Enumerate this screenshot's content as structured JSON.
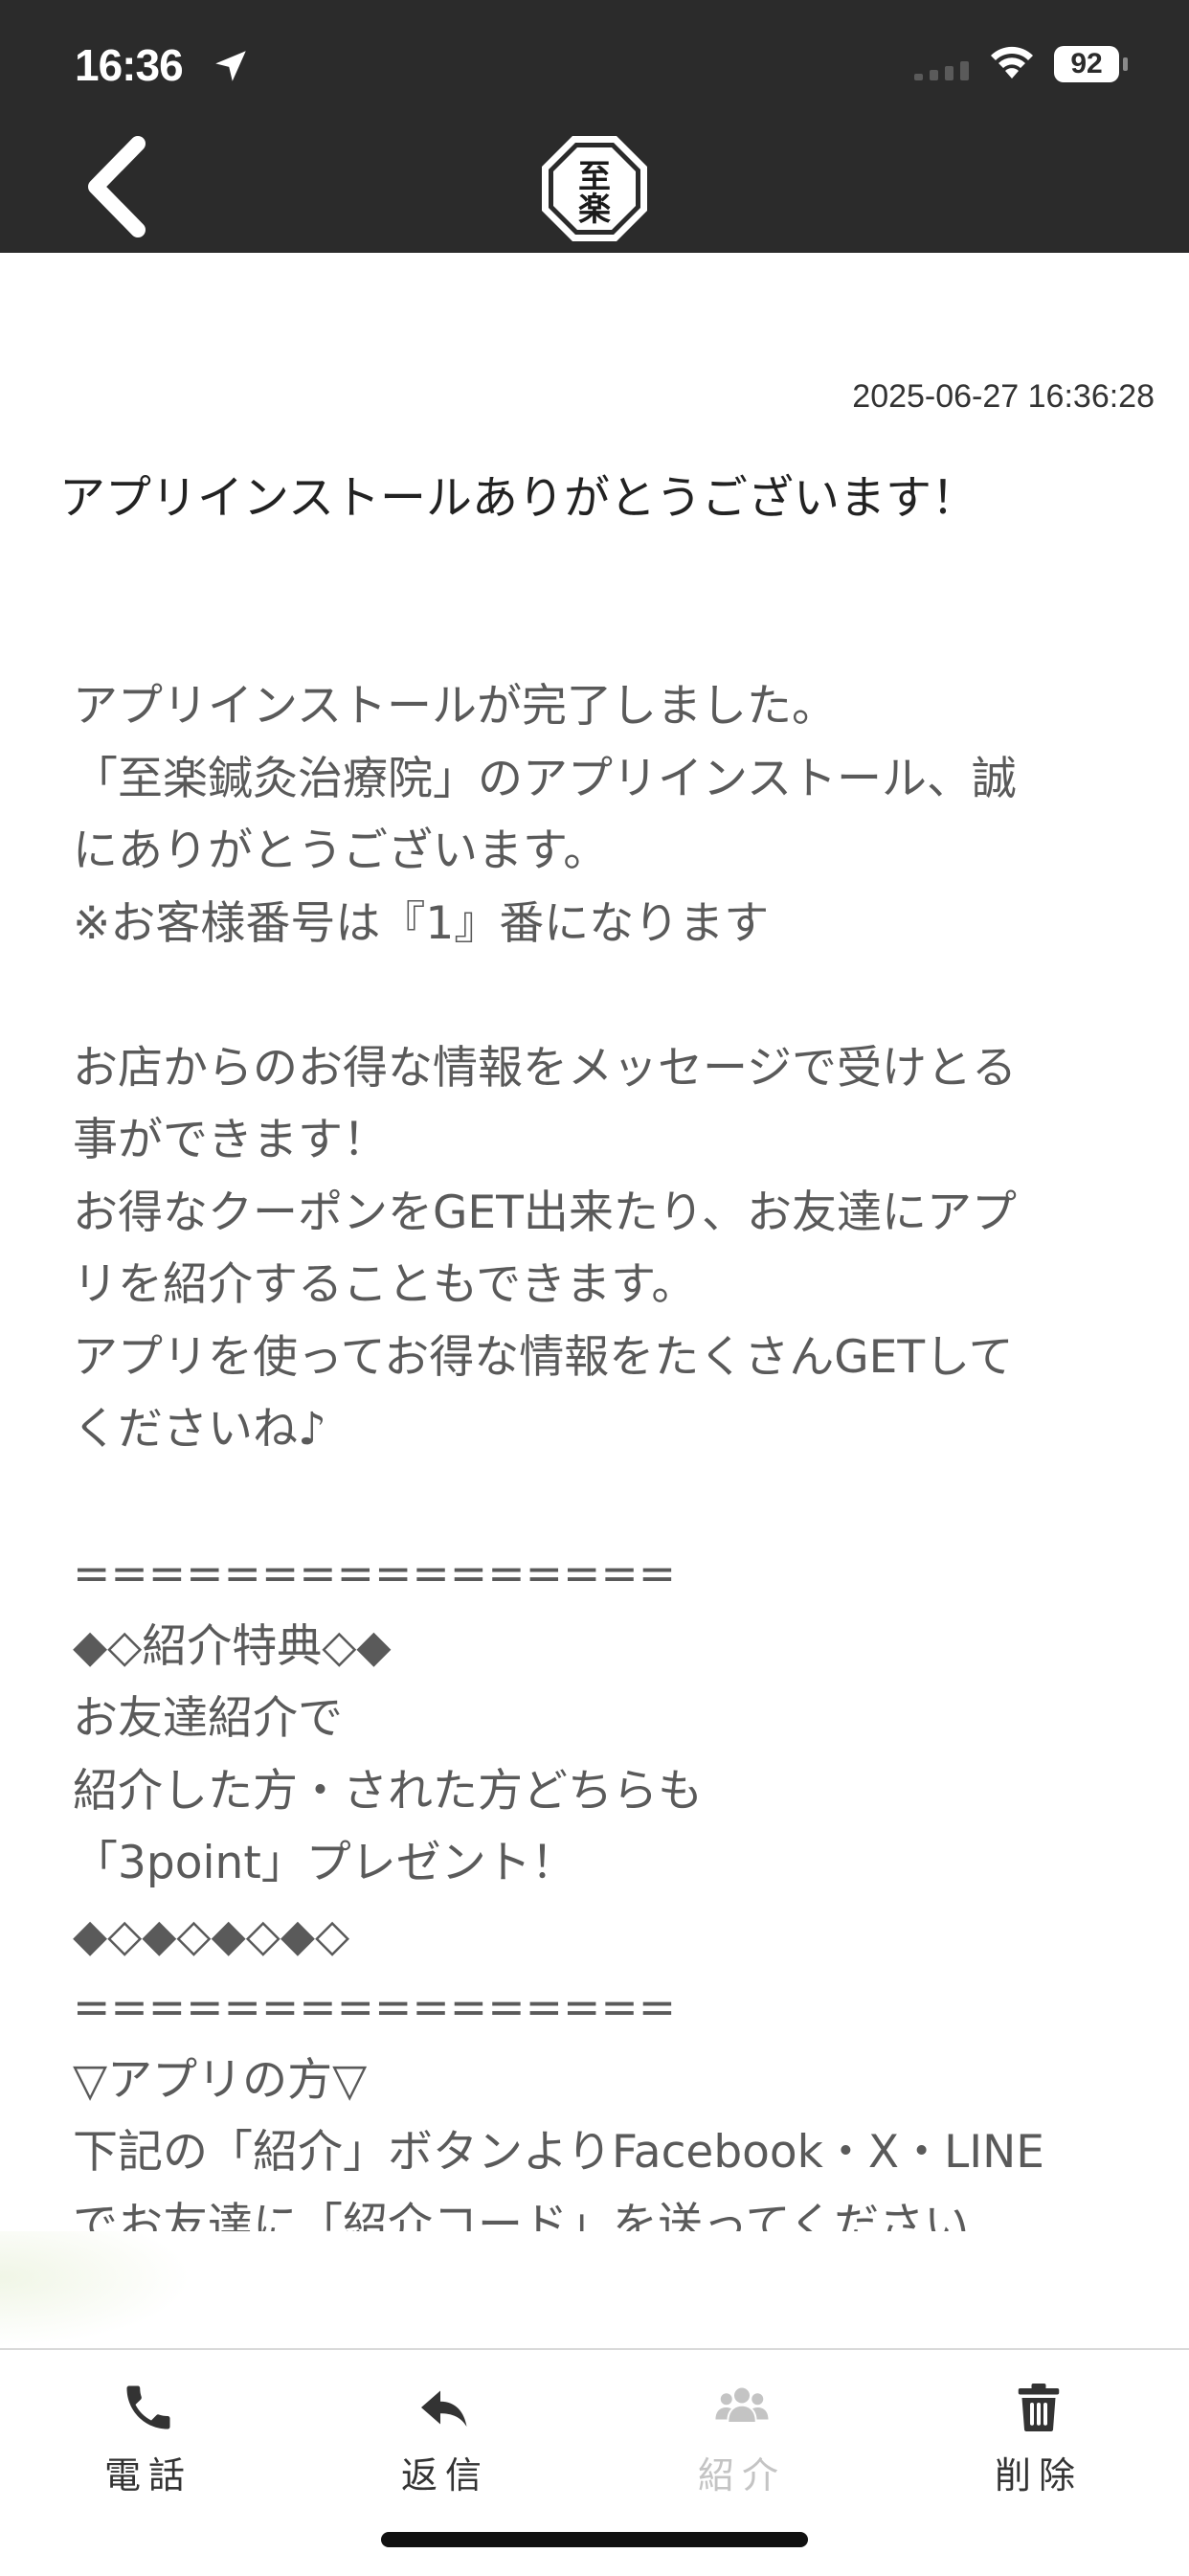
{
  "status_bar": {
    "time": "16:36",
    "battery": "92"
  },
  "header": {
    "back_icon": "chevron-left-icon",
    "logo_text": "至楽",
    "logo_icon": "octagon-logo"
  },
  "message": {
    "timestamp": "2025-06-27 16:36:28",
    "title": "アプリインストールありがとうございます！",
    "body_lines": [
      "アプリインストールが完了しました。",
      "「至楽鍼灸治療院」のアプリインストール、誠",
      "にありがとうございます。",
      "※お客様番号は『1』番になります",
      "",
      "お店からのお得な情報をメッセージで受けとる",
      "事ができます！",
      "お得なクーポンをGET出来たり、お友達にアプ",
      "リを紹介することもできます。",
      "アプリを使ってお得な情報をたくさんGETして",
      "くださいね♪",
      "",
      "================",
      "◆◇紹介特典◇◆",
      "お友達紹介で",
      "紹介した方・された方どちらも",
      "「3point」プレゼント！",
      "◆◇◆◇◆◇◆◇",
      "================",
      "▽アプリの方▽",
      "下記の「紹介」ボタンよりFacebook・X・LINE",
      "でお友達に「紹介コード」を送ってください"
    ]
  },
  "footer": {
    "tabs": [
      {
        "label": "電話",
        "icon": "phone-icon",
        "enabled": true
      },
      {
        "label": "返信",
        "icon": "reply-icon",
        "enabled": true
      },
      {
        "label": "紹介",
        "icon": "group-icon",
        "enabled": false
      },
      {
        "label": "削除",
        "icon": "trash-icon",
        "enabled": true
      }
    ]
  },
  "colors": {
    "header_bg": "#2b2b2b",
    "body_text": "#5a5a5a",
    "disabled_tab": "#c4c4c4"
  }
}
